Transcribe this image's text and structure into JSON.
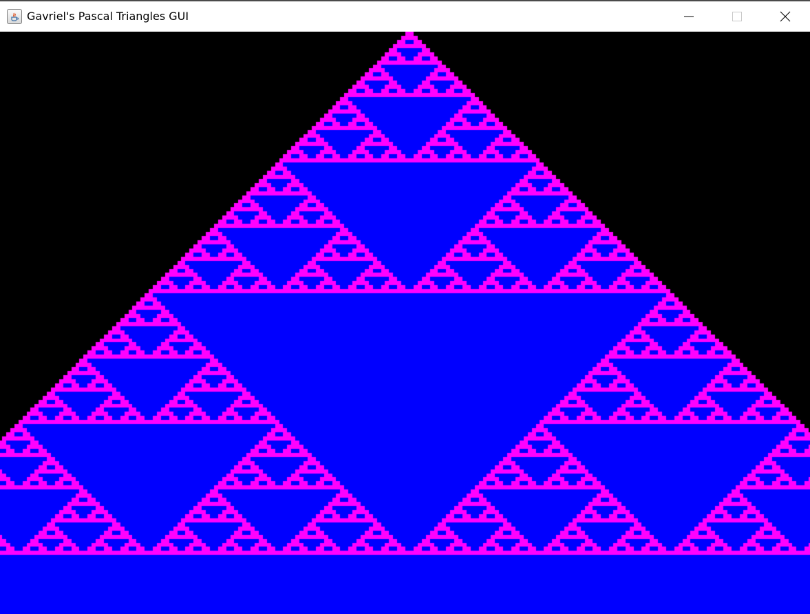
{
  "window": {
    "title": "Gavriel's Pascal Triangles GUI",
    "app_icon": "java-icon",
    "controls": {
      "minimize_icon": "minimize-icon",
      "maximize_icon": "maximize-icon",
      "close_icon": "close-icon"
    }
  },
  "pascal_triangle": {
    "colors": {
      "background": "#000000",
      "odd_cell": "#ff00ff",
      "even_cell": "#0000ff"
    },
    "modulus": 2
  }
}
